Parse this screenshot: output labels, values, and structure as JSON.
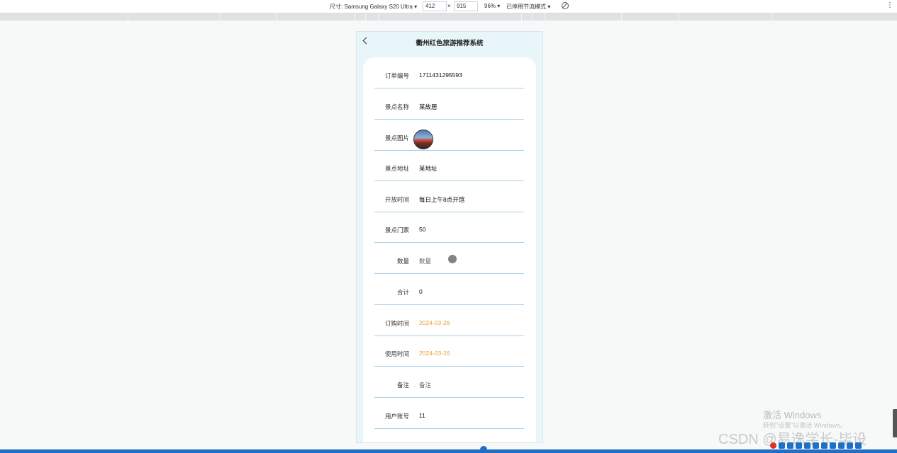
{
  "devtools": {
    "size_label": "尺寸: Samsung Galaxy S20 Ultra ▾",
    "width": "412",
    "times": "×",
    "height": "915",
    "zoom": "96% ▾",
    "throttle": "已停用节流模式 ▾",
    "icons": [
      "rotate-icon",
      "kebab-menu-icon"
    ]
  },
  "app": {
    "title": "衢州红色旅游推荐系统",
    "fields": [
      {
        "label": "订单编号",
        "value": "1711431295593",
        "type": "text"
      },
      {
        "label": "景点名称",
        "value": "某故居",
        "type": "text"
      },
      {
        "label": "景点图片",
        "value": "",
        "type": "image"
      },
      {
        "label": "景点地址",
        "value": "某地址",
        "type": "text"
      },
      {
        "label": "开放时间",
        "value": "每日上午8点开馆",
        "type": "text"
      },
      {
        "label": "景点门票",
        "value": "50",
        "type": "text"
      },
      {
        "label": "数量",
        "value": "数量",
        "type": "input"
      },
      {
        "label": "合计",
        "value": "0",
        "type": "text"
      },
      {
        "label": "订购时间",
        "value": "2024-03-26",
        "type": "date"
      },
      {
        "label": "使用时间",
        "value": "2024-03-26",
        "type": "date"
      },
      {
        "label": "备注",
        "value": "备注",
        "type": "input"
      },
      {
        "label": "用户账号",
        "value": "11",
        "type": "text"
      }
    ]
  },
  "overlay": {
    "activate_title": "激活 Windows",
    "activate_hint": "转到\"设置\"以激活 Windows。",
    "csdn": "CSDN @易逸学长-毕设"
  },
  "colors": {
    "accent_date": "#e8a33a",
    "divider": "#a9cfe6",
    "phone_bg": "#e9f6f9"
  }
}
